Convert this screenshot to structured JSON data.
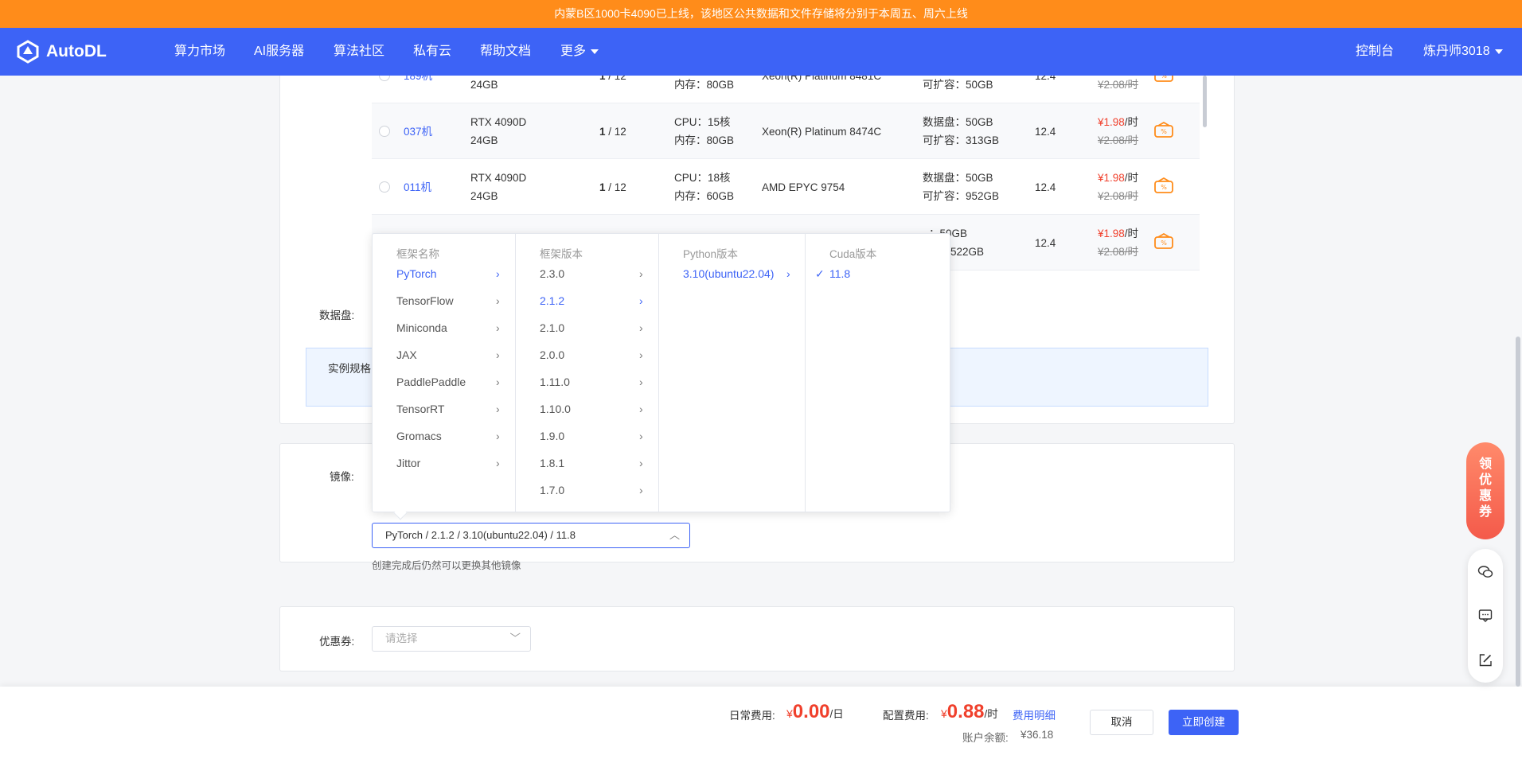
{
  "announcement": "内蒙B区1000卡4090已上线，该地区公共数据和文件存储将分别于本周五、周六上线",
  "nav": {
    "logo": "AutoDL",
    "items": [
      "算力市场",
      "AI服务器",
      "算法社区",
      "私有云",
      "帮助文档",
      "更多"
    ],
    "console": "控制台",
    "user": "炼丹师3018"
  },
  "machines": [
    {
      "name": "189机",
      "gpu": "",
      "vram": "24GB",
      "avail": "1",
      "total": "/ 12",
      "cpu": "",
      "mem": "内存：80GB",
      "cpu_model": "Xeon(R) Platinum 8481C",
      "disk": "",
      "expand": "可扩容：50GB",
      "cuda": "12.4",
      "price": "",
      "orig": "¥2.08/时"
    },
    {
      "name": "037机",
      "gpu": "RTX 4090D",
      "vram": "24GB",
      "avail": "1",
      "total": "/ 12",
      "cpu": "CPU：15核",
      "mem": "内存：80GB",
      "cpu_model": "Xeon(R) Platinum 8474C",
      "disk": "数据盘：50GB",
      "expand": "可扩容：313GB",
      "cuda": "12.4",
      "price_sym": "¥",
      "price_val": "1.98",
      "price_unit": "/时",
      "orig": "¥2.08/时"
    },
    {
      "name": "011机",
      "gpu": "RTX 4090D",
      "vram": "24GB",
      "avail": "1",
      "total": "/ 12",
      "cpu": "CPU：18核",
      "mem": "内存：60GB",
      "cpu_model": "AMD EPYC 9754",
      "disk": "数据盘：50GB",
      "expand": "可扩容：952GB",
      "cuda": "12.4",
      "price_sym": "¥",
      "price_val": "1.98",
      "price_unit": "/时",
      "orig": "¥2.08/时"
    },
    {
      "name": "",
      "gpu": "",
      "vram": "",
      "avail": "",
      "total": "",
      "cpu": "",
      "mem": "",
      "cpu_model": "",
      "disk": "：50GB",
      "expand": "容：522GB",
      "cuda": "12.4",
      "price_sym": "¥",
      "price_val": "1.98",
      "price_unit": "/时",
      "orig": "¥2.08/时"
    }
  ],
  "labels": {
    "data_disk": "数据盘:",
    "spec": "实例规格",
    "image": "镜像:",
    "coupon": "优惠券:"
  },
  "cascader": {
    "col1_head": "框架名称",
    "frameworks": [
      "PyTorch",
      "TensorFlow",
      "Miniconda",
      "JAX",
      "PaddlePaddle",
      "TensorRT",
      "Gromacs",
      "Jittor"
    ],
    "col2_head": "框架版本",
    "versions": [
      "2.3.0",
      "2.1.2",
      "2.1.0",
      "2.0.0",
      "1.11.0",
      "1.10.0",
      "1.9.0",
      "1.8.1",
      "1.7.0"
    ],
    "col3_head": "Python版本",
    "pythons": [
      "3.10(ubuntu22.04)"
    ],
    "col4_head": "Cuda版本",
    "cudas": [
      "11.8"
    ],
    "selected_framework": "PyTorch",
    "selected_version": "2.1.2",
    "selected_python": "3.10(ubuntu22.04)",
    "selected_cuda": "11.8"
  },
  "image_select": {
    "value": "PyTorch / 2.1.2 / 3.10(ubuntu22.04) / 11.8",
    "hint": "创建完成后仍然可以更换其他镜像"
  },
  "coupon_select": {
    "placeholder": "请选择"
  },
  "footer": {
    "daily_label": "日常费用:",
    "daily_sym": "¥",
    "daily_value": "0.00",
    "daily_unit": "/日",
    "config_label": "配置费用:",
    "config_sym": "¥",
    "config_value": "0.88",
    "config_unit": "/时",
    "fee_detail": "费用明细",
    "balance_label": "账户余额:",
    "balance_value": "¥36.18",
    "cancel": "取消",
    "create": "立即创建"
  },
  "float_coupon": "领优惠券",
  "colors": {
    "primary": "#3d63f6",
    "announce": "#ff8c1a",
    "price": "#f0402c"
  }
}
